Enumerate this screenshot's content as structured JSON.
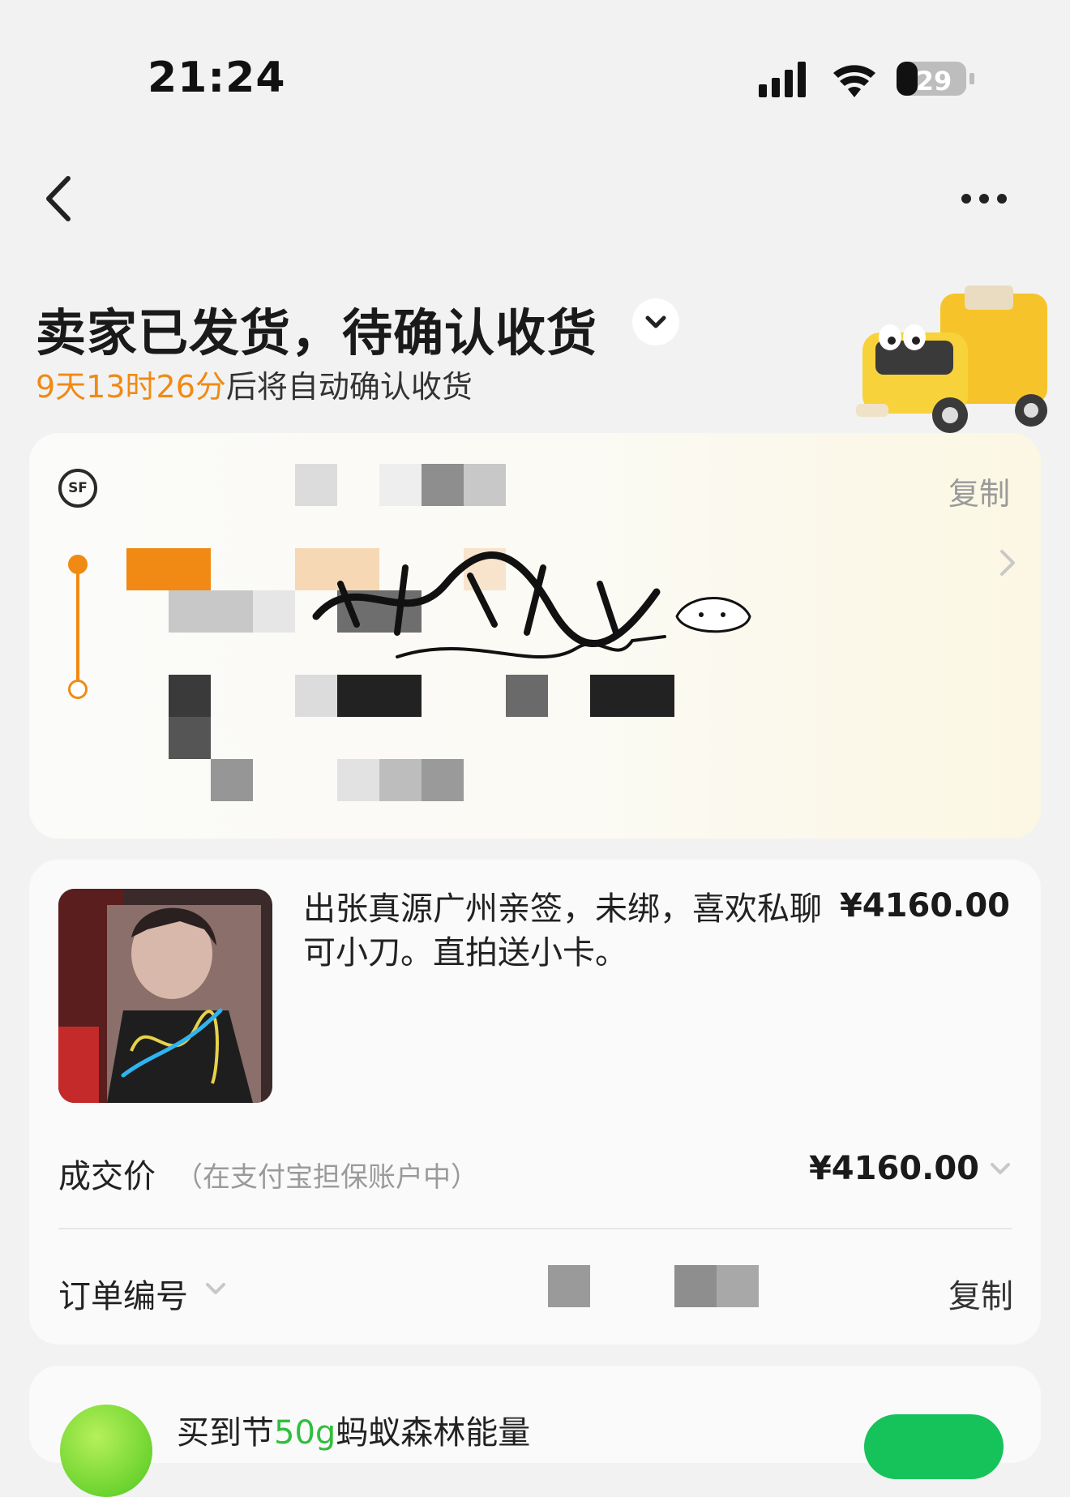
{
  "status_bar": {
    "time": "21:24",
    "battery": "29"
  },
  "nav": {
    "back_icon": "chevron-left-icon",
    "more_icon": "more-dots-icon"
  },
  "header": {
    "title": "卖家已发货，待确认收货",
    "countdown": "9天13时26分",
    "auto_confirm_text": "后将自动确认收货"
  },
  "logistics": {
    "carrier_icon": "sf-express-logo",
    "copy_label": "复制",
    "accent_color": "#f08a14"
  },
  "product": {
    "title": "出张真源广州亲签，未绑，喜欢私聊可小刀。直拍送小卡。",
    "price": "¥4160.00"
  },
  "deal": {
    "label": "成交价",
    "note": "（在支付宝担保账户中）",
    "price": "¥4160.00"
  },
  "order": {
    "label": "订单编号",
    "copy_label": "复制"
  },
  "promo": {
    "text_prefix": "买到节",
    "text_highlight": "50g",
    "text_suffix": "蚂蚁森林能量",
    "highlight_color": "#2fbf3c"
  }
}
